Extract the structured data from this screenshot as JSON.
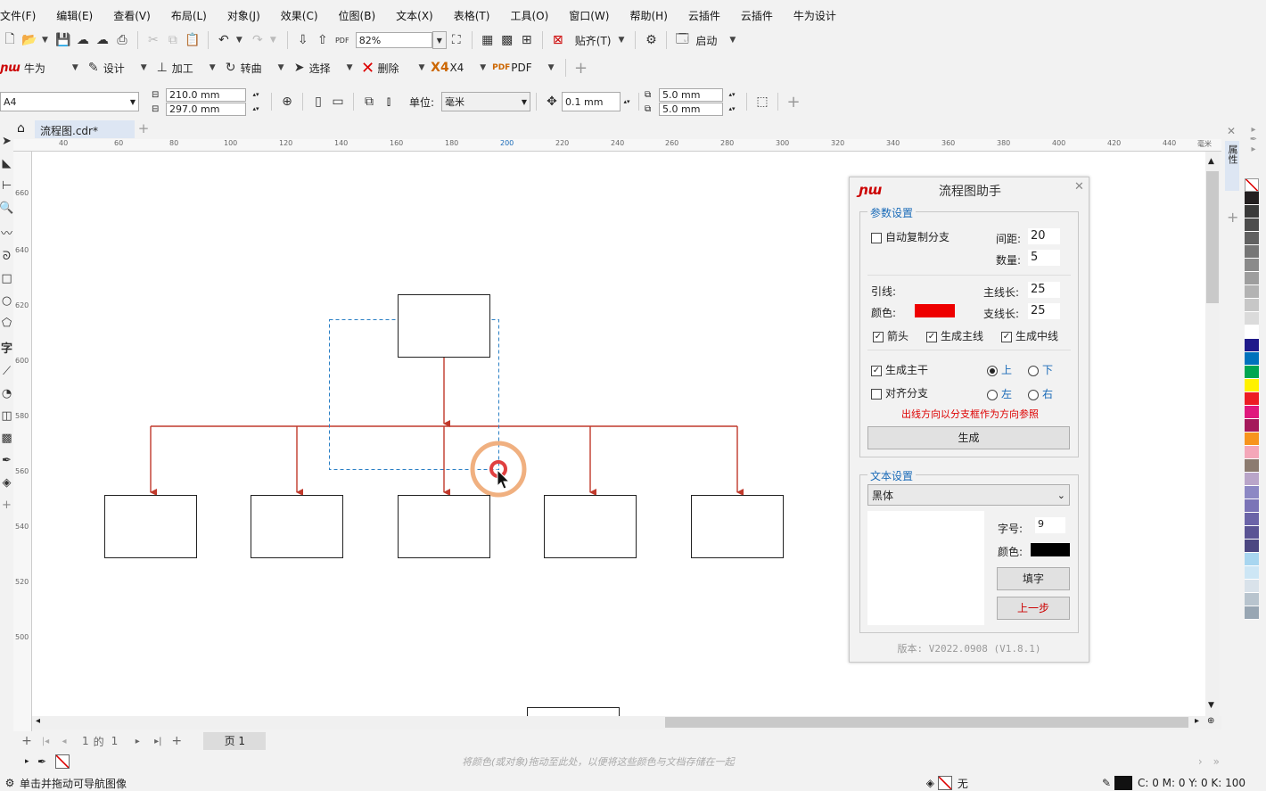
{
  "menu": [
    "文件(F)",
    "编辑(E)",
    "查看(V)",
    "布局(L)",
    "对象(J)",
    "效果(C)",
    "位图(B)",
    "文本(X)",
    "表格(T)",
    "工具(O)",
    "窗口(W)",
    "帮助(H)",
    "云插件",
    "云插件",
    "牛为设计"
  ],
  "toolbar1": {
    "zoom": "82%",
    "snap": "贴齐(T)",
    "launch": "启动"
  },
  "toolbar2": {
    "brand": "牛为",
    "design": "设计",
    "process": "加工",
    "convert": "转曲",
    "select": "选择",
    "delete": "删除",
    "x4": "X4",
    "pdf": "PDF"
  },
  "propbar": {
    "page_size": "A4",
    "width": "210.0 mm",
    "height": "297.0 mm",
    "unit_label": "单位:",
    "unit": "毫米",
    "nudge": "0.1 mm",
    "dup_x": "5.0 mm",
    "dup_y": "5.0 mm"
  },
  "doc_tab": "流程图.cdr*",
  "ruler_top": [
    "40",
    "60",
    "80",
    "100",
    "120",
    "140",
    "160",
    "180",
    "200",
    "220",
    "240",
    "260",
    "280",
    "300",
    "320",
    "340",
    "360",
    "380",
    "400",
    "420",
    "440",
    "毫米"
  ],
  "ruler_left": [
    "660",
    "640",
    "620",
    "600",
    "580",
    "560",
    "540",
    "520",
    "500"
  ],
  "page_nav": {
    "current": "1",
    "of": "的",
    "total": "1",
    "tab": "页 1"
  },
  "palette_hint": "将颜色(或对象)拖动至此处，以便将这些颜色与文档存储在一起",
  "status": {
    "hint": "单击并拖动可导航图像",
    "fill": "无",
    "cmyk": "C: 0 M: 0 Y: 0 K: 100"
  },
  "docker_tab": "属性",
  "plugin": {
    "title": "流程图助手",
    "logo": "ɲɯ",
    "params_title": "参数设置",
    "auto_copy": "自动复制分支",
    "spacing_label": "间距:",
    "spacing": "20",
    "count_label": "数量:",
    "count": "5",
    "lead_label": "引线:",
    "main_len_label": "主线长:",
    "main_len": "25",
    "color_label": "颜色:",
    "branch_len_label": "支线长:",
    "branch_len": "25",
    "arrow": "箭头",
    "gen_main_line": "生成主线",
    "gen_mid_line": "生成中线",
    "gen_trunk": "生成主干",
    "up": "上",
    "down": "下",
    "align_branch": "对齐分支",
    "left": "左",
    "right": "右",
    "note": "出线方向以分支框作为方向参照",
    "generate": "生成",
    "text_title": "文本设置",
    "font": "黑体",
    "size_label": "字号:",
    "size": "9",
    "text_color_label": "颜色:",
    "fill_btn": "填字",
    "back_btn": "上一步",
    "version": "版本: V2022.0908 (V1.8.1)",
    "line_color": "#ee0000",
    "text_color": "#000000"
  },
  "palette": [
    "#231f20",
    "#3a3a3a",
    "#4d4d4d",
    "#616161",
    "#767676",
    "#8a8a8a",
    "#9e9e9e",
    "#b3b3b3",
    "#c7c7c7",
    "#dbdbdb",
    "#ffffff",
    "#1f1a8a",
    "#0072bc",
    "#00a651",
    "#fff200",
    "#ed1c24",
    "#e0187d",
    "#a4195b",
    "#f7941d",
    "#f4a7b9",
    "#8c7b70",
    "#b9a5c9",
    "#8c88c4",
    "#7b74b7",
    "#6b64a8",
    "#5a5494",
    "#4c4781",
    "#a8d6f0",
    "#cde6f5",
    "#d9e2ea",
    "#b8c4ce",
    "#98a6b3"
  ]
}
